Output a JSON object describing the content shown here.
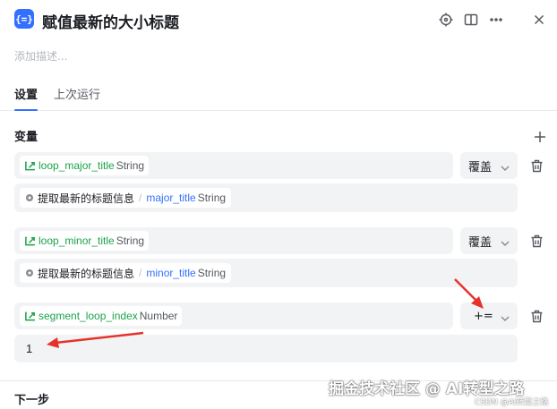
{
  "header": {
    "app_icon_text": "{=}",
    "title": "赋值最新的大小标题",
    "icons": [
      "locate-icon",
      "split-view-icon",
      "more-icon",
      "close-icon"
    ]
  },
  "description_placeholder": "添加描述...",
  "tabs": [
    {
      "label": "设置",
      "active": true
    },
    {
      "label": "上次运行",
      "active": false
    }
  ],
  "variables_section": {
    "title": "变量",
    "rows": [
      {
        "var_name": "loop_major_title",
        "var_type": "String",
        "operator": "覆盖",
        "value_ref": {
          "node": "提取最新的标题信息",
          "field": "major_title",
          "type": "String"
        }
      },
      {
        "var_name": "loop_minor_title",
        "var_type": "String",
        "operator": "覆盖",
        "value_ref": {
          "node": "提取最新的标题信息",
          "field": "minor_title",
          "type": "String"
        }
      },
      {
        "var_name": "segment_loop_index",
        "var_type": "Number",
        "operator": "+=",
        "value_input": "1"
      }
    ]
  },
  "next_section_title": "下一步",
  "watermark": {
    "main": "掘金技术社区 @ AI转型之路",
    "sub": "CSDN @AI转型之路"
  },
  "colors": {
    "accent": "#3370ff",
    "variable_green": "#1aa34a",
    "field_bg": "#f2f3f5",
    "annotation_red": "#e5332a"
  }
}
